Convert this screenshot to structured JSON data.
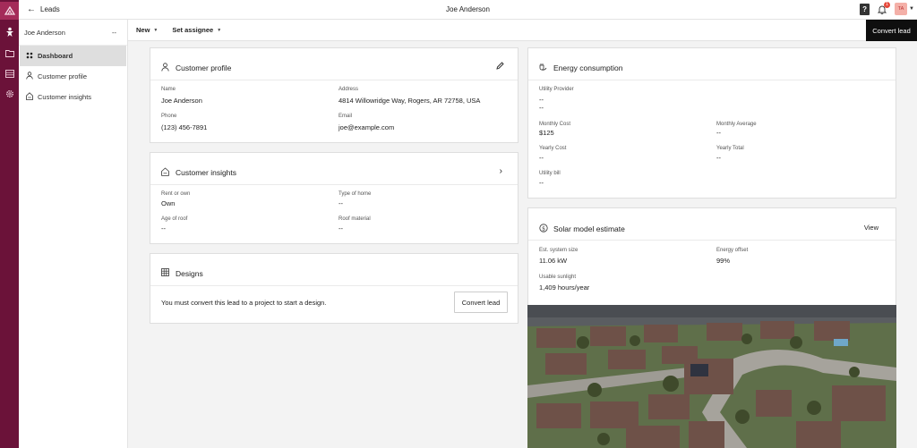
{
  "topbar": {
    "back_label": "Leads",
    "page_title": "Joe Anderson",
    "help_label": "?",
    "notifications_count": "1",
    "avatar_initials": "TA"
  },
  "sidebar": {
    "header_name": "Joe Anderson",
    "header_more": "--",
    "items": [
      {
        "label": "Dashboard",
        "icon": "dashboard-icon"
      },
      {
        "label": "Customer profile",
        "icon": "user-icon"
      },
      {
        "label": "Customer insights",
        "icon": "house-document-icon"
      }
    ]
  },
  "toolbar": {
    "new_label": "New",
    "assignee_label": "Set assignee",
    "convert_label": "Convert lead"
  },
  "customer_profile": {
    "title": "Customer profile",
    "name_label": "Name",
    "name": "Joe Anderson",
    "address_label": "Address",
    "address": "4814 Willowridge Way, Rogers, AR 72758, USA",
    "phone_label": "Phone",
    "phone": "(123) 456-7891",
    "email_label": "Email",
    "email": "joe@example.com"
  },
  "customer_insights": {
    "title": "Customer insights",
    "rent_label": "Rent or own",
    "rent": "Own",
    "home_label": "Type of home",
    "home": "--",
    "age_label": "Age of roof",
    "age": "--",
    "material_label": "Roof material",
    "material": "--"
  },
  "designs": {
    "title": "Designs",
    "message": "You must convert this lead to a project to start a design.",
    "button_label": "Convert lead"
  },
  "energy": {
    "title": "Energy consumption",
    "provider_label": "Utility Provider",
    "provider_1": "--",
    "provider_2": "--",
    "monthly_cost_label": "Monthly Cost",
    "monthly_cost": "$125",
    "monthly_avg_label": "Monthly Average",
    "monthly_avg": "--",
    "yearly_cost_label": "Yearly Cost",
    "yearly_cost": "--",
    "yearly_total_label": "Yearly Total",
    "yearly_total": "--",
    "bill_label": "Utility bill",
    "bill": "--"
  },
  "solar": {
    "title": "Solar model estimate",
    "view_label": "View",
    "size_label": "Est. system size",
    "size": "11.06 kW",
    "offset_label": "Energy offset",
    "offset": "99%",
    "sunlight_label": "Usable sunlight",
    "sunlight": "1,409 hours/year"
  },
  "colors": {
    "rail": "#6b1239",
    "rail_logo": "#a42b59",
    "dark_button": "#0f0f0f",
    "badge": "#e5483a"
  }
}
